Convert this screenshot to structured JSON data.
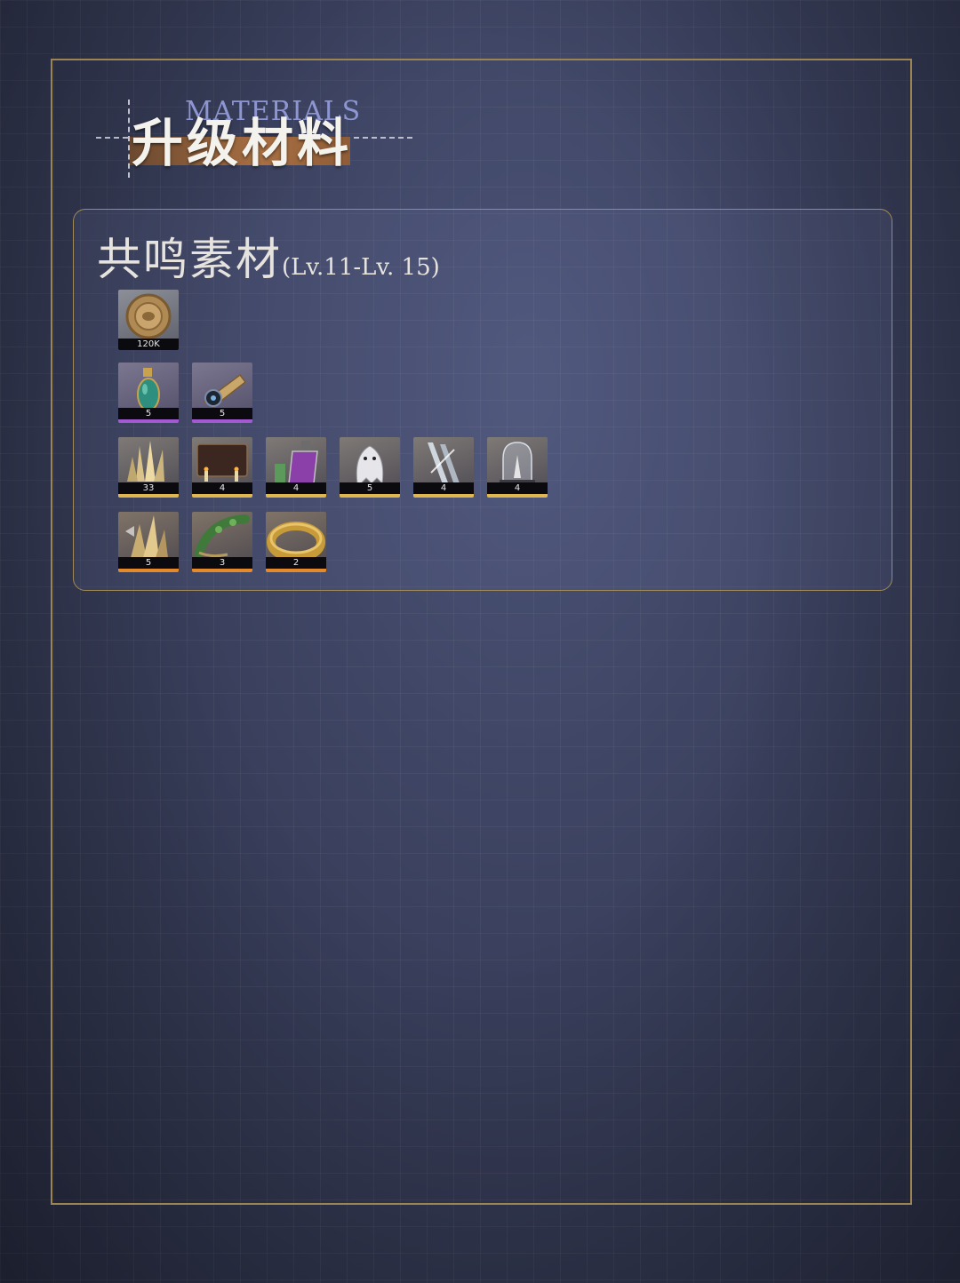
{
  "header": {
    "title_en": "MATERIALS",
    "title_cn": "升级材料"
  },
  "panel": {
    "title": "共鸣素材",
    "level_range": "(Lv.11-Lv. 15)",
    "rows": [
      {
        "items": [
          {
            "icon": "gold-coin-icon",
            "count": "120K",
            "rarity": "gray"
          }
        ]
      },
      {
        "items": [
          {
            "icon": "potion-flask-icon",
            "count": "5",
            "rarity": "purple"
          },
          {
            "icon": "crossbow-device-icon",
            "count": "5",
            "rarity": "purple"
          }
        ]
      },
      {
        "items": [
          {
            "icon": "crystal-cluster-icon",
            "count": "33",
            "rarity": "gold"
          },
          {
            "icon": "ouija-board-icon",
            "count": "4",
            "rarity": "gold"
          },
          {
            "icon": "purple-potion-icon",
            "count": "4",
            "rarity": "gold"
          },
          {
            "icon": "ghost-cloth-icon",
            "count": "5",
            "rarity": "gold"
          },
          {
            "icon": "silver-blades-icon",
            "count": "4",
            "rarity": "gold"
          },
          {
            "icon": "glass-dome-icon",
            "count": "4",
            "rarity": "gold"
          }
        ]
      },
      {
        "items": [
          {
            "icon": "golden-crystal-icon",
            "count": "5",
            "rarity": "orange"
          },
          {
            "icon": "laurel-wreath-icon",
            "count": "3",
            "rarity": "orange"
          },
          {
            "icon": "gold-ring-icon",
            "count": "2",
            "rarity": "orange"
          }
        ]
      }
    ]
  },
  "colors": {
    "frame": "#9c8453",
    "title_bar": "#a86f42",
    "rarity_purple": "#a35ad0",
    "rarity_gold": "#e0b650",
    "rarity_orange": "#e48a2a"
  }
}
